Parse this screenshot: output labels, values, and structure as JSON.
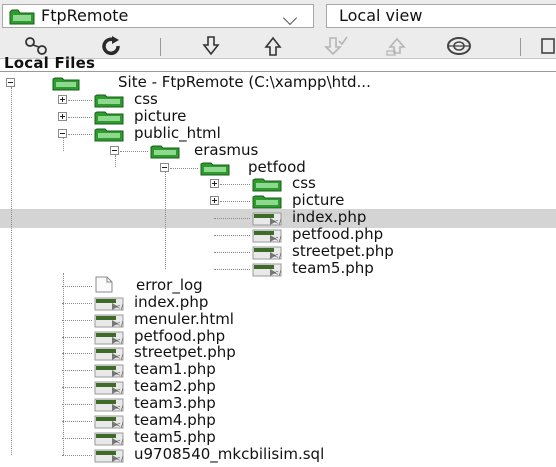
{
  "toolbar": {
    "site_select": "FtpRemote",
    "view_select": "Local view",
    "buttons": [
      {
        "icon": "connect-icon"
      },
      {
        "icon": "refresh-icon"
      },
      {
        "icon": "get-icon"
      },
      {
        "icon": "put-icon"
      },
      {
        "icon": "checkout-icon"
      },
      {
        "icon": "checkin-icon"
      },
      {
        "icon": "sync-icon"
      },
      {
        "icon": "expand-icon"
      }
    ]
  },
  "panel": {
    "header": "Local Files"
  },
  "colors": {
    "folder": "#2e9b2e",
    "php_icon": "#3d6b28",
    "highlight": "#d4d4d4"
  },
  "tree": [
    {
      "label": "Site - FtpRemote (C:\\xampp\\htd...",
      "icon": "site-icon",
      "depth": 0,
      "expander": "minus"
    },
    {
      "label": "css",
      "icon": "folder-icon",
      "depth": 1,
      "expander": "plus"
    },
    {
      "label": "picture",
      "icon": "folder-icon",
      "depth": 1,
      "expander": "plus"
    },
    {
      "label": "public_html",
      "icon": "folder-icon",
      "depth": 1,
      "expander": "minus"
    },
    {
      "label": "erasmus",
      "icon": "folder-icon",
      "depth": 2,
      "expander": "minus"
    },
    {
      "label": "petfood",
      "icon": "folder-icon",
      "depth": 3,
      "expander": "minus"
    },
    {
      "label": "css",
      "icon": "folder-icon",
      "depth": 4,
      "expander": "plus"
    },
    {
      "label": "picture",
      "icon": "folder-icon",
      "depth": 4,
      "expander": "plus"
    },
    {
      "label": "index.php",
      "icon": "php-file-icon",
      "depth": 4,
      "selected": true
    },
    {
      "label": "petfood.php",
      "icon": "php-file-icon",
      "depth": 4
    },
    {
      "label": "streetpet.php",
      "icon": "php-file-icon",
      "depth": 4
    },
    {
      "label": "team5.php",
      "icon": "php-file-icon",
      "depth": 4
    },
    {
      "label": "error_log",
      "icon": "file-icon",
      "depth": 1
    },
    {
      "label": "index.php",
      "icon": "php-file-icon",
      "depth": 1
    },
    {
      "label": "menuler.html",
      "icon": "php-file-icon",
      "depth": 1
    },
    {
      "label": "petfood.php",
      "icon": "php-file-icon",
      "depth": 1
    },
    {
      "label": "streetpet.php",
      "icon": "php-file-icon",
      "depth": 1
    },
    {
      "label": "team1.php",
      "icon": "php-file-icon",
      "depth": 1
    },
    {
      "label": "team2.php",
      "icon": "php-file-icon",
      "depth": 1
    },
    {
      "label": "team3.php",
      "icon": "php-file-icon",
      "depth": 1
    },
    {
      "label": "team4.php",
      "icon": "php-file-icon",
      "depth": 1
    },
    {
      "label": "team5.php",
      "icon": "php-file-icon",
      "depth": 1
    },
    {
      "label": "u9708540_mkcbilisim.sql",
      "icon": "php-file-icon",
      "depth": 1
    }
  ]
}
